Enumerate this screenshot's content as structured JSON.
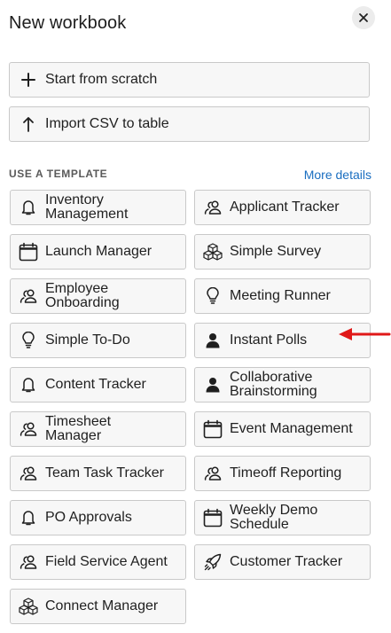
{
  "dialog": {
    "title": "New workbook",
    "close_label": "×"
  },
  "actions": [
    {
      "label": "Start from scratch",
      "icon": "plus-icon"
    },
    {
      "label": "Import CSV to table",
      "icon": "arrow-up-icon"
    }
  ],
  "templates_section": {
    "heading": "USE A TEMPLATE",
    "more_link": "More details"
  },
  "templates": [
    {
      "label": "Inventory Management",
      "lines": [
        "Inventory",
        "Management"
      ],
      "icon": "bell-icon"
    },
    {
      "label": "Applicant Tracker",
      "lines": [
        "Applicant Tracker"
      ],
      "icon": "users-icon"
    },
    {
      "label": "Launch Manager",
      "lines": [
        "Launch Manager"
      ],
      "icon": "calendar-icon"
    },
    {
      "label": "Simple Survey",
      "lines": [
        "Simple Survey"
      ],
      "icon": "cubes-icon"
    },
    {
      "label": "Employee Onboarding",
      "lines": [
        "Employee",
        "Onboarding"
      ],
      "icon": "users-icon"
    },
    {
      "label": "Meeting Runner",
      "lines": [
        "Meeting Runner"
      ],
      "icon": "lightbulb-icon"
    },
    {
      "label": "Simple To-Do",
      "lines": [
        "Simple To-Do"
      ],
      "icon": "lightbulb-icon"
    },
    {
      "label": "Instant Polls",
      "lines": [
        "Instant Polls"
      ],
      "icon": "person-icon"
    },
    {
      "label": "Content Tracker",
      "lines": [
        "Content Tracker"
      ],
      "icon": "bell-icon"
    },
    {
      "label": "Collaborative Brainstorming",
      "lines": [
        "Collaborative",
        "Brainstorming"
      ],
      "icon": "person-icon"
    },
    {
      "label": "Timesheet Manager",
      "lines": [
        "Timesheet",
        "Manager"
      ],
      "icon": "users-icon"
    },
    {
      "label": "Event Management",
      "lines": [
        "Event Management"
      ],
      "icon": "calendar-icon"
    },
    {
      "label": "Team Task Tracker",
      "lines": [
        "Team Task Tracker"
      ],
      "icon": "users-icon"
    },
    {
      "label": "Timeoff Reporting",
      "lines": [
        "Timeoff Reporting"
      ],
      "icon": "users-icon"
    },
    {
      "label": "PO Approvals",
      "lines": [
        "PO Approvals"
      ],
      "icon": "bell-icon"
    },
    {
      "label": "Weekly Demo Schedule",
      "lines": [
        "Weekly Demo",
        "Schedule"
      ],
      "icon": "calendar-icon"
    },
    {
      "label": "Field Service Agent",
      "lines": [
        "Field Service Agent"
      ],
      "icon": "users-icon"
    },
    {
      "label": "Customer Tracker",
      "lines": [
        "Customer Tracker"
      ],
      "icon": "rocket-icon"
    },
    {
      "label": "Connect Manager",
      "lines": [
        "Connect Manager"
      ],
      "icon": "cubes-icon"
    }
  ],
  "annotation": {
    "icon": "red-arrow-icon",
    "color": "#e01818"
  },
  "colors": {
    "link": "#1a6ec0",
    "button_bg": "#f7f7f7",
    "button_border": "#c9c9c9"
  }
}
